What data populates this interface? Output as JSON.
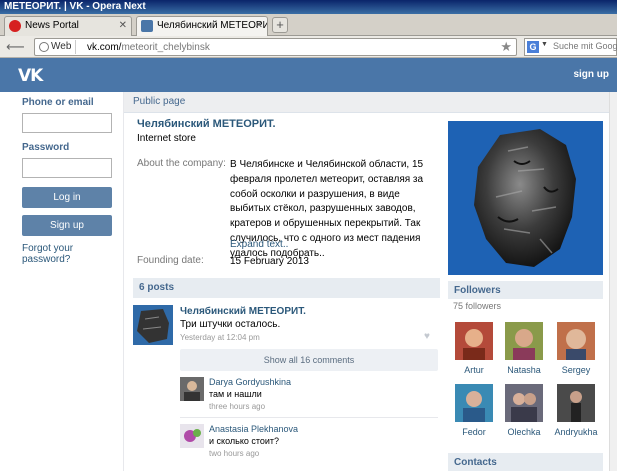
{
  "window": {
    "title": "МЕТЕОРИТ. | VK - Opera Next"
  },
  "tabs": [
    {
      "label": "News Portal",
      "active": false,
      "favicon": "opera-icon"
    },
    {
      "label": "Челябинский МЕТЕОРИТ.",
      "active": true,
      "favicon": "vk-icon"
    }
  ],
  "address": {
    "badge": "Web",
    "host": "vk.com/",
    "path": "meteorit_chelybinsk",
    "search_engine": "G",
    "search_placeholder": "Suche mit Google"
  },
  "vk_header": {
    "logo": "VK",
    "signup_label": "sign up"
  },
  "login": {
    "phone_label": "Phone or email",
    "password_label": "Password",
    "login_button": "Log in",
    "signup_button": "Sign up",
    "forgot_link": "Forgot your password?"
  },
  "page": {
    "header": "Public page",
    "title": "Челябинский МЕТЕОРИТ.",
    "subtitle": "Internet store",
    "about_label": "About the company:",
    "about_text": "В Челябинске и Челябинской области, 15 февраля пролетел метеорит, оставляя за собой осколки и разрушения, в виде выбитых стёкол, разрушенных заводов, кратеров и обрушенных перекрытий. Так случилось, что с одного из мест падения удалось подобрать..",
    "expand_label": "Expand text..",
    "founding_label": "Founding date:",
    "founding_value": "15 February 2013"
  },
  "posts": {
    "header": "6 posts",
    "items": [
      {
        "author": "Челябинский МЕТЕОРИТ.",
        "text": "Три штучки осталось.",
        "time": "Yesterday at 12:04 pm",
        "show_all": "Show all 16 comments",
        "comments": [
          {
            "name": "Darya Gordyushkina",
            "text": "там и нашли",
            "time": "three hours ago"
          },
          {
            "name": "Anastasia Plekhanova",
            "text": "и сколько стоит?",
            "time": "two hours ago"
          }
        ]
      }
    ]
  },
  "followers": {
    "header": "Followers",
    "count": "75 followers",
    "items": [
      {
        "name": "Artur",
        "color": "#b44a3a"
      },
      {
        "name": "Natasha",
        "color": "#8a9a4a"
      },
      {
        "name": "Sergey",
        "color": "#c0704a"
      },
      {
        "name": "Fedor",
        "color": "#3a8ab4"
      },
      {
        "name": "Olechka",
        "color": "#6a6a7a"
      },
      {
        "name": "Andryukha",
        "color": "#5a5a5a"
      }
    ]
  },
  "contacts": {
    "header": "Contacts"
  },
  "colors": {
    "vk_blue": "#4a76a8",
    "link": "#2b587a",
    "accent": "#45688e"
  }
}
